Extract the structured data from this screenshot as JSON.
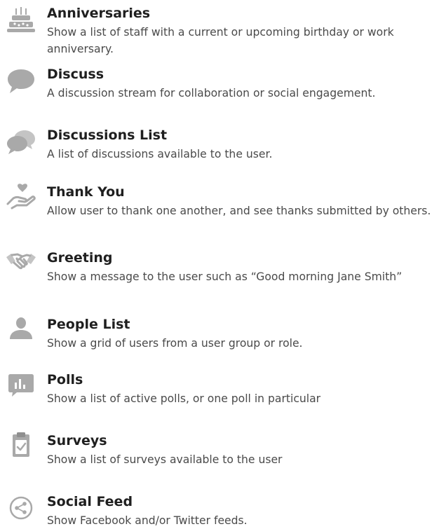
{
  "widgets": [
    {
      "title": "Anniversaries",
      "description": "Show a list of staff with a current or upcoming birthday or work anniversary.",
      "icon": "birthday-cake-icon"
    },
    {
      "title": "Discuss",
      "description": "A discussion stream for collaboration or social engagement.",
      "icon": "speech-bubble-icon"
    },
    {
      "title": "Discussions List",
      "description": "A list of discussions available to the user.",
      "icon": "conversation-bubbles-icon"
    },
    {
      "title": "Thank You",
      "description": "Allow user to thank one another, and see thanks submitted by others.",
      "icon": "hand-heart-icon"
    },
    {
      "title": "Greeting",
      "description": "Show a message to the user such as “Good morning Jane Smith”",
      "icon": "handshake-icon"
    },
    {
      "title": "People List",
      "description": "Show a grid of users from a user group or role.",
      "icon": "person-icon"
    },
    {
      "title": "Polls",
      "description": "Show a list of active polls, or one poll in particular",
      "icon": "poll-chart-icon"
    },
    {
      "title": "Surveys",
      "description": "Show a list of surveys available to the user",
      "icon": "clipboard-check-icon"
    },
    {
      "title": "Social Feed",
      "description": "Show Facebook and/or Twitter feeds.",
      "icon": "share-circle-icon"
    }
  ],
  "colors": {
    "icon": "#a9a9a9",
    "title": "#1f1f1f",
    "description": "#4a4a4a",
    "background": "#ffffff"
  }
}
